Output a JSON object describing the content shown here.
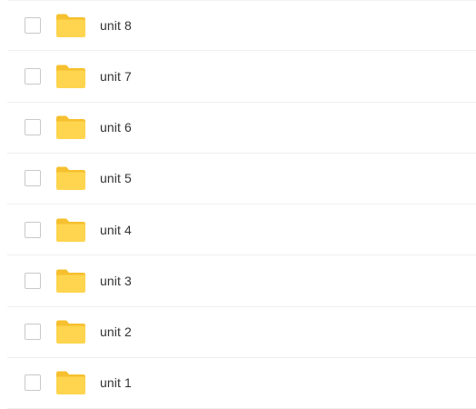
{
  "colors": {
    "folder_front": "#FFD54F",
    "folder_back": "#F6C02E",
    "checkbox_border": "#C9C9C9",
    "text": "#333333",
    "row_divider": "#EFEFEF"
  },
  "files": {
    "items": [
      {
        "name": "unit 8",
        "type": "folder",
        "icon": "folder-icon",
        "checked": false
      },
      {
        "name": "unit 7",
        "type": "folder",
        "icon": "folder-icon",
        "checked": false
      },
      {
        "name": "unit 6",
        "type": "folder",
        "icon": "folder-icon",
        "checked": false
      },
      {
        "name": "unit 5",
        "type": "folder",
        "icon": "folder-icon",
        "checked": false
      },
      {
        "name": "unit 4",
        "type": "folder",
        "icon": "folder-icon",
        "checked": false
      },
      {
        "name": "unit 3",
        "type": "folder",
        "icon": "folder-icon",
        "checked": false
      },
      {
        "name": "unit 2",
        "type": "folder",
        "icon": "folder-icon",
        "checked": false
      },
      {
        "name": "unit 1",
        "type": "folder",
        "icon": "folder-icon",
        "checked": false
      }
    ]
  }
}
